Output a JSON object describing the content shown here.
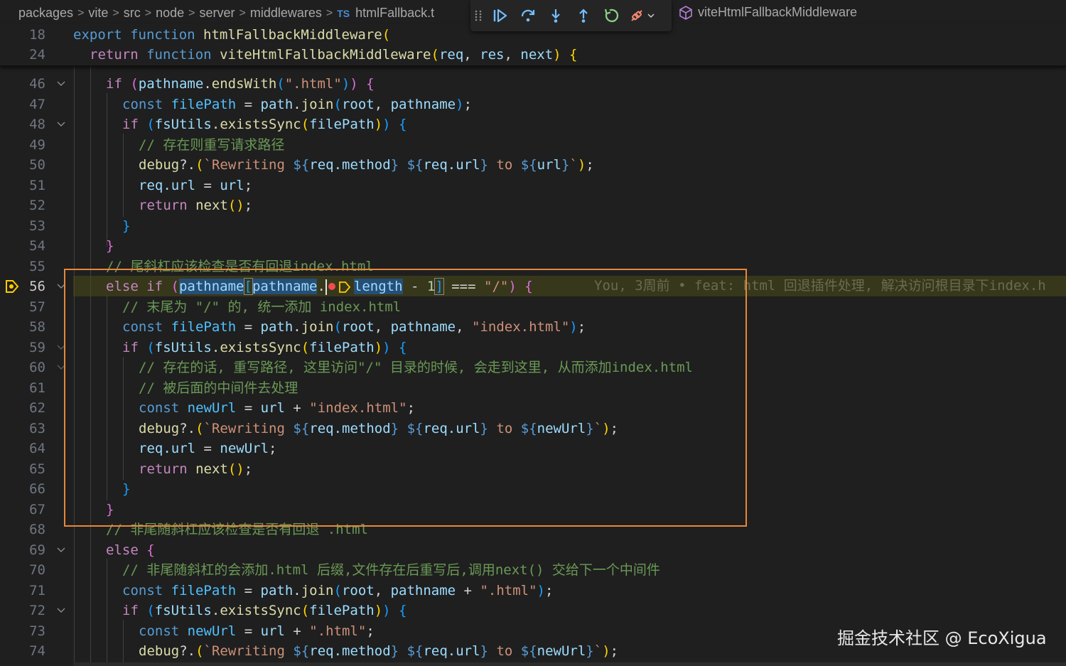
{
  "breadcrumb": {
    "items": [
      "packages",
      "vite",
      "src",
      "node",
      "server",
      "middlewares"
    ],
    "file_lang": "TS",
    "file_name": "htmlFallback.t",
    "symbol": "viteHtmlFallbackMiddleware"
  },
  "debug_toolbar": {
    "buttons": [
      "drag-grip",
      "continue",
      "step-over",
      "step-into",
      "step-out",
      "restart",
      "disconnect"
    ]
  },
  "sticky_lines": [
    {
      "num": "18",
      "text": "export function htmlFallbackMiddleware("
    },
    {
      "num": "24",
      "text": "  return function viteHtmlFallbackMiddleware(req, res, next) {"
    }
  ],
  "lines": [
    {
      "num": "46"
    },
    {
      "num": "47"
    },
    {
      "num": "48"
    },
    {
      "num": "49"
    },
    {
      "num": "50"
    },
    {
      "num": "51"
    },
    {
      "num": "52"
    },
    {
      "num": "53"
    },
    {
      "num": "54"
    },
    {
      "num": "55"
    },
    {
      "num": "56"
    },
    {
      "num": "57"
    },
    {
      "num": "58"
    },
    {
      "num": "59"
    },
    {
      "num": "60"
    },
    {
      "num": "61"
    },
    {
      "num": "62"
    },
    {
      "num": "63"
    },
    {
      "num": "64"
    },
    {
      "num": "65"
    },
    {
      "num": "66"
    },
    {
      "num": "67"
    },
    {
      "num": "68"
    },
    {
      "num": "69"
    },
    {
      "num": "70"
    },
    {
      "num": "71"
    },
    {
      "num": "72"
    },
    {
      "num": "73"
    },
    {
      "num": "74"
    }
  ],
  "code": {
    "l46_a": "if",
    "l46_b": "(",
    "l46_c": "pathname",
    "l46_d": ".",
    "l46_e": "endsWith",
    "l46_f": "\".html\"",
    "l47_a": "const",
    "l47_b": "filePath",
    "l47_c": "path",
    "l47_d": "join",
    "l47_e": "root",
    "l47_f": "pathname",
    "l48_a": "if",
    "l48_b": "fsUtils",
    "l48_c": "existsSync",
    "l48_d": "filePath",
    "l49": "// 存在则重写请求路径",
    "l50_a": "debug",
    "l50_b": "`Rewriting ",
    "l50_c": "req.method",
    "l50_d": "req.url",
    "l50_e": " to ",
    "l50_f": "url",
    "l51_a": "req.url",
    "l51_b": "url",
    "l52_a": "return",
    "l52_b": "next",
    "l55": "// 尾斜杠应该检查是否有回退index.html",
    "l56_a": "else if",
    "l56_b": "pathname",
    "l56_c": "pathname",
    "l56_d": "length",
    "l56_e": "1",
    "l56_f": "\"/\"",
    "l57": "// 末尾为 \"/\" 的, 统一添加 index.html",
    "l58_a": "const",
    "l58_b": "filePath",
    "l58_c": "path",
    "l58_d": "join",
    "l58_e": "root",
    "l58_f": "pathname",
    "l58_g": "\"index.html\"",
    "l59_a": "if",
    "l59_b": "fsUtils",
    "l59_c": "existsSync",
    "l59_d": "filePath",
    "l60": "// 存在的话, 重写路径, 这里访问\"/\" 目录的时候, 会走到这里, 从而添加index.html",
    "l61": "// 被后面的中间件去处理",
    "l62_a": "const",
    "l62_b": "newUrl",
    "l62_c": "url",
    "l62_d": "\"index.html\"",
    "l63_a": "debug",
    "l63_b": "`Rewriting ",
    "l63_c": "req.method",
    "l63_d": "req.url",
    "l63_e": " to ",
    "l63_f": "newUrl",
    "l64_a": "req.url",
    "l64_b": "newUrl",
    "l65_a": "return",
    "l65_b": "next",
    "l68": "// 非尾随斜杠应该检查是否有回退 .html",
    "l69_a": "else",
    "l70": "// 非尾随斜杠的会添加.html 后缀,文件存在后重写后,调用next() 交给下一个中间件",
    "l71_a": "const",
    "l71_b": "filePath",
    "l71_c": "path",
    "l71_d": "join",
    "l71_e": "root",
    "l71_f": "pathname",
    "l71_g": "\".html\"",
    "l72_a": "if",
    "l72_b": "fsUtils",
    "l72_c": "existsSync",
    "l72_d": "filePath",
    "l73_a": "const",
    "l73_b": "newUrl",
    "l73_c": "url",
    "l73_d": "\".html\"",
    "l74_a": "debug",
    "l74_b": "`Rewriting ",
    "l74_c": "req.method",
    "l74_d": "req.url",
    "l74_e": " to ",
    "l74_f": "newUrl"
  },
  "blame": "You, 3周前 • feat: html 回退插件处理, 解决访问根目录下index.h",
  "watermark": "掘金技术社区 @ EcoXigua",
  "colors": {
    "background": "#1f1f1f",
    "keyword": "#569cd6",
    "control": "#c586c0",
    "function": "#dcdcaa",
    "variable": "#9cdcfe",
    "string": "#ce9178",
    "comment": "#6a9955",
    "annotation_box": "#e8873a",
    "breakpoint": "#f14c4c",
    "debug_arrow": "#ffcc00"
  }
}
